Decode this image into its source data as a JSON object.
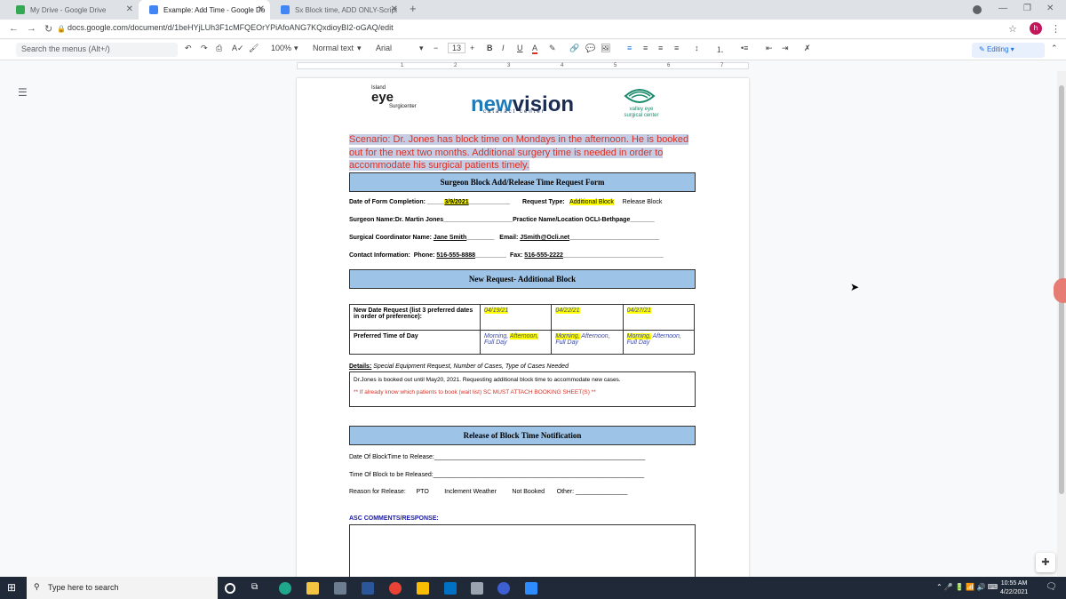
{
  "browser": {
    "tabs": [
      {
        "title": "My Drive - Google Drive",
        "color": "#34a853"
      },
      {
        "title": "Example: Add Time - Google Do",
        "color": "#4285f4"
      },
      {
        "title": "Sx Block time, ADD ONLY-Script",
        "color": "#4285f4"
      }
    ],
    "url": "docs.google.com/document/d/1beHYjLUh3F1cMFQEOrYPiAfoANG7KQxdioyBI2-oGAQ/edit",
    "profile_initial": "h"
  },
  "toolbar": {
    "search_placeholder": "Search the menus (Alt+/)",
    "zoom": "100%",
    "style": "Normal text",
    "font": "Arial",
    "font_size": "13",
    "mode": "Editing"
  },
  "ruler": [
    "1",
    "2",
    "3",
    "4",
    "5",
    "6",
    "7"
  ],
  "logos": {
    "island_top": "Island",
    "island_main": "eye",
    "island_sub": "Surgicenter",
    "newvision_a": "new",
    "newvision_b": "vision",
    "newvision_sub": "cataract center",
    "valley": "valley eye surgical center"
  },
  "document": {
    "scenario": "Scenario: Dr. Jones has block time on Mondays in the afternoon. He is booked out for the next two months. Additional surgery time is needed in order to accommodate his surgical patients timely.",
    "form_title": "Surgeon Block Add/Release Time Request Form",
    "date_label": "Date of Form Completion: _____",
    "date_value": "3/9/2021",
    "date_tail": "____________",
    "request_type_label": "Request Type:",
    "request_type_add": "Additional Block",
    "request_type_release": "Release Block",
    "surgeon_label": "Surgeon Name:",
    "surgeon_value": "Dr. Martin Jones",
    "surgeon_tail": "____________________",
    "practice_label": "Practice Name/Location",
    "practice_value": "OCLI-Bethpage",
    "practice_tail": "_______",
    "coordinator_label": "Surgical Coordinator Name:",
    "coordinator_value": "Jane Smith",
    "coordinator_tail": "________",
    "email_label": "Email:",
    "email_value": "JSmith@Ocli.net",
    "email_tail": "__________________________",
    "contact_label": "Contact Information:",
    "phone_label": "Phone:",
    "phone_value": "516-555-8888",
    "phone_tail": "_________",
    "fax_label": "Fax:",
    "fax_value": "516-555-2222",
    "fax_tail": "_____________________________",
    "new_request_title": "New Request- Additional Block",
    "date_request_label": "New Date Request (list 3 preferred dates in order of preference):",
    "dates": [
      "04/19/21",
      "04/22/21",
      "04/27/21"
    ],
    "preferred_time_label": "Preferred Time of Day",
    "time_opts": [
      "Morning,",
      "Afternoon,",
      "Full  Day"
    ],
    "details_label": "Details:",
    "details_hint": "Special Equipment Request, Number of Cases, Type of Cases Needed",
    "details_text": "Dr.Jones is booked out until May20, 2021.  Requesting additional block time to accommodate new cases.",
    "details_note": "** If already know which patients to book (wait list) SC MUST ATTACH BOOKING SHEET(S) **",
    "release_title": "Release of Block Time Notification",
    "release_date_label": "Date Of BlockTime to Release:",
    "release_date_tail": "_____________________________________________________________",
    "release_time_label": "Time Of Block to be Released:",
    "release_time_tail": "_____________________________________________________________",
    "reason_label": "Reason for Release:",
    "reasons": [
      "PTO",
      "Inclement Weather",
      "Not Booked",
      "Other: _______________"
    ],
    "asc_label": "ASC COMMENTS/RESPONSE:"
  },
  "taskbar": {
    "search_placeholder": "Type here to search",
    "time": "10:55 AM",
    "date": "4/22/2021"
  }
}
